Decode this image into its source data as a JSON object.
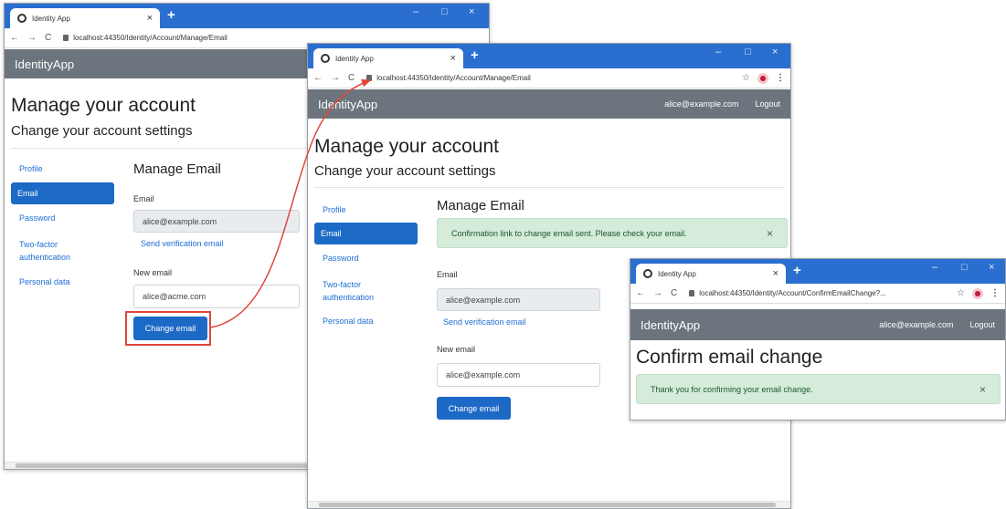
{
  "browser": {
    "tab_title": "Identity App",
    "new_tab": "+",
    "minimize": "–",
    "maximize": "□",
    "close": "×",
    "back": "←",
    "forward": "→",
    "reload": "C",
    "star": "☆",
    "menu": "⋮"
  },
  "windows": {
    "w1": {
      "url": "localhost:44350/Identity/Account/Manage/Email"
    },
    "w2": {
      "url": "localhost:44350/Identity/Account/Manage/Email"
    },
    "w3": {
      "url": "localhost:44350/Identity/Account/ConfirmEmailChange?..."
    }
  },
  "app": {
    "brand": "IdentityApp",
    "user": "alice@example.com",
    "logout": "Logout"
  },
  "manage": {
    "title": "Manage your account",
    "subtitle": "Change your account settings",
    "sidebar": [
      "Profile",
      "Email",
      "Password",
      "Two-factor\nauthentication",
      "Personal data"
    ],
    "heading": "Manage Email",
    "email_label": "Email",
    "current_email": "alice@example.com",
    "send_verification": "Send verification email",
    "new_email_label": "New email",
    "change_button": "Change email"
  },
  "w1_new_email": "alice@acme.com",
  "w2_new_email": "alice@example.com",
  "w2_alert": "Confirmation link to change email sent. Please check your email.",
  "confirm": {
    "title": "Confirm email change",
    "alert": "Thank you for confirming your email change."
  },
  "alert_close": "×",
  "colors": {
    "tabbar": "#2a6fd0",
    "navbar": "#6c757d",
    "primary": "#1c69c6",
    "alert_bg": "#d4ecd9",
    "arrow": "#e0463a"
  }
}
